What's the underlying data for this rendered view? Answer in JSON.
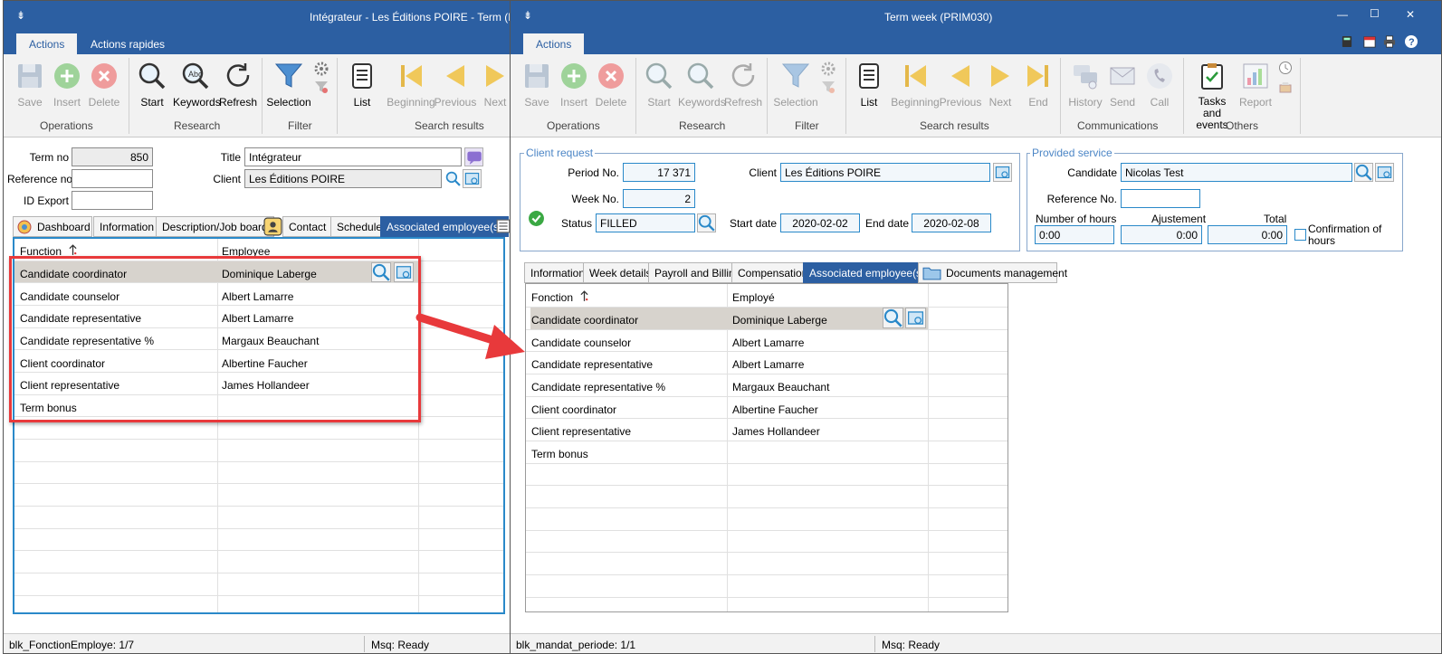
{
  "left": {
    "window_title": "Intégrateur - Les Éditions POIRE - Term (PRIM",
    "menu_glyph": "⇟",
    "ribbon_tabs": [
      "Actions",
      "Actions rapides"
    ],
    "buttons": {
      "save": "Save",
      "insert": "Insert",
      "delete": "Delete",
      "start": "Start",
      "keywords": "Keywords",
      "refresh": "Refresh",
      "selection": "Selection",
      "list": "List",
      "beginning": "Beginning",
      "previous": "Previous",
      "next": "Next"
    },
    "groups": {
      "operations": "Operations",
      "research": "Research",
      "filter": "Filter",
      "search_results": "Search results"
    },
    "form": {
      "term_no_label": "Term no",
      "term_no": "850",
      "reference_no_label": "Reference no",
      "reference_no": "",
      "id_export_label": "ID Export",
      "id_export": "",
      "title_label": "Title",
      "title": "Intégrateur",
      "client_label": "Client",
      "client": "Les Éditions POIRE"
    },
    "tabs": [
      "Dashboard",
      "Information",
      "Description/Job board",
      "Contact",
      "Schedule",
      "Associated employee(s)"
    ],
    "grid": {
      "col_function": "Function",
      "col_employee": "Employee",
      "rows": [
        {
          "function": "Candidate  coordinator",
          "employee": "Dominique Laberge"
        },
        {
          "function": "Candidate counselor",
          "employee": "Albert Lamarre"
        },
        {
          "function": "Candidate representative",
          "employee": "Albert Lamarre"
        },
        {
          "function": "Candidate representative %",
          "employee": "Margaux Beauchant"
        },
        {
          "function": "Client coordinator",
          "employee": "Albertine Faucher"
        },
        {
          "function": "Client representative",
          "employee": "James Hollandeer"
        },
        {
          "function": "Term bonus",
          "employee": ""
        }
      ]
    },
    "status": {
      "block": "blk_FonctionEmploye: 1/7",
      "msg": "Msq: Ready"
    }
  },
  "right": {
    "window_title": "Term week (PRIM030)",
    "menu_glyph": "⇟",
    "window_controls": {
      "minimize": "—",
      "maximize": "☐",
      "close": "✕"
    },
    "ribbon_tabs": [
      "Actions"
    ],
    "buttons": {
      "save": "Save",
      "insert": "Insert",
      "delete": "Delete",
      "start": "Start",
      "keywords": "Keywords",
      "refresh": "Refresh",
      "selection": "Selection",
      "list": "List",
      "beginning": "Beginning",
      "previous": "Previous",
      "next": "Next",
      "end": "End",
      "history": "History",
      "send": "Send",
      "call": "Call",
      "tasks_line1": "Tasks and",
      "tasks_line2": "events",
      "report": "Report"
    },
    "groups": {
      "operations": "Operations",
      "research": "Research",
      "filter": "Filter",
      "search_results": "Search results",
      "communications": "Communications",
      "others": "Others"
    },
    "client_request": {
      "legend": "Client request",
      "period_no_label": "Period No.",
      "period_no": "17 371",
      "week_no_label": "Week No.",
      "week_no": "2",
      "status_label": "Status",
      "status": "FILLED",
      "client_label": "Client",
      "client": "Les Éditions POIRE",
      "start_date_label": "Start date",
      "start_date": "2020-02-02",
      "end_date_label": "End date",
      "end_date": "2020-02-08"
    },
    "provided_service": {
      "legend": "Provided service",
      "candidate_label": "Candidate",
      "candidate": "Nicolas Test",
      "reference_no_label": "Reference No.",
      "reference_no": "",
      "hours_label": "Number of hours",
      "hours": "0:00",
      "adjust_label": "Ajustement",
      "adjust": "0:00",
      "total_label": "Total",
      "total": "0:00",
      "confirm_line1": "Confirmation of",
      "confirm_line2": "hours"
    },
    "tabs": [
      "Information",
      "Week details",
      "Payroll and Billing",
      "Compensation",
      "Associated employee(s)",
      "Documents management"
    ],
    "grid": {
      "col_function": "Fonction",
      "col_employee": "Employé",
      "rows": [
        {
          "function": "Candidate  coordinator",
          "employee": "Dominique Laberge"
        },
        {
          "function": "Candidate counselor",
          "employee": "Albert Lamarre"
        },
        {
          "function": "Candidate representative",
          "employee": "Albert Lamarre"
        },
        {
          "function": "Candidate representative %",
          "employee": "Margaux Beauchant"
        },
        {
          "function": "Client coordinator",
          "employee": "Albertine Faucher"
        },
        {
          "function": "Client representative",
          "employee": "James Hollandeer"
        },
        {
          "function": "Term bonus",
          "employee": ""
        }
      ]
    },
    "status": {
      "block": "blk_mandat_periode: 1/1",
      "msg": "Msq: Ready"
    }
  },
  "colors": {
    "title_bar": "#2c5fa2",
    "highlight_box": "#e8393b",
    "selected_row": "#d7d3cd",
    "accent": "#2a89c9"
  }
}
